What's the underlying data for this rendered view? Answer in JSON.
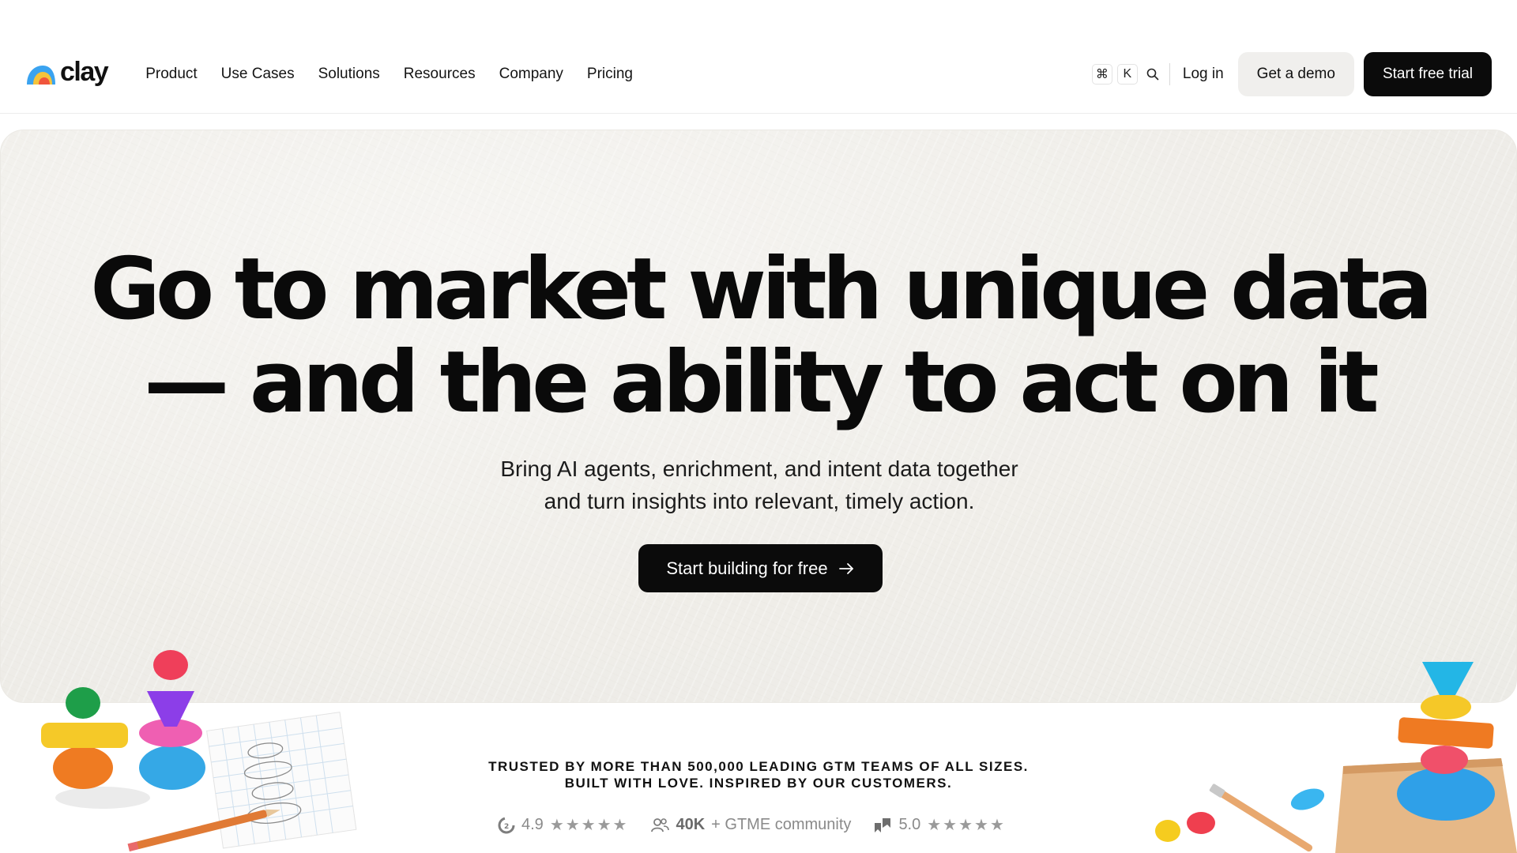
{
  "brand": {
    "name": "clay"
  },
  "nav": {
    "links": [
      "Product",
      "Use Cases",
      "Solutions",
      "Resources",
      "Company",
      "Pricing"
    ],
    "shortcut_cmd": "⌘",
    "shortcut_key": "K",
    "login": "Log in",
    "demo": "Get a demo",
    "trial": "Start free trial"
  },
  "hero": {
    "title_line1": "Go to market with unique data",
    "title_line2": "— and the ability to act on it",
    "subtitle_line1": "Bring AI agents, enrichment, and intent data together",
    "subtitle_line2": "and turn insights into relevant, timely action.",
    "cta": "Start building for free",
    "cta_icon": "arrow-right-icon"
  },
  "trust": {
    "line1": "TRUSTED BY MORE THAN 500,000 LEADING GTM TEAMS OF ALL SIZES.",
    "line2": "BUILT WITH LOVE. INSPIRED BY OUR CUSTOMERS."
  },
  "ratings": {
    "g2_score": "4.9",
    "g2_stars": "★★★★★",
    "community_count": "40K",
    "community_label": "+ GTME community",
    "review_score": "5.0",
    "review_stars": "★★★★★"
  },
  "colors": {
    "accent": "#0b0b0b",
    "hero_bg": "#efede8"
  }
}
